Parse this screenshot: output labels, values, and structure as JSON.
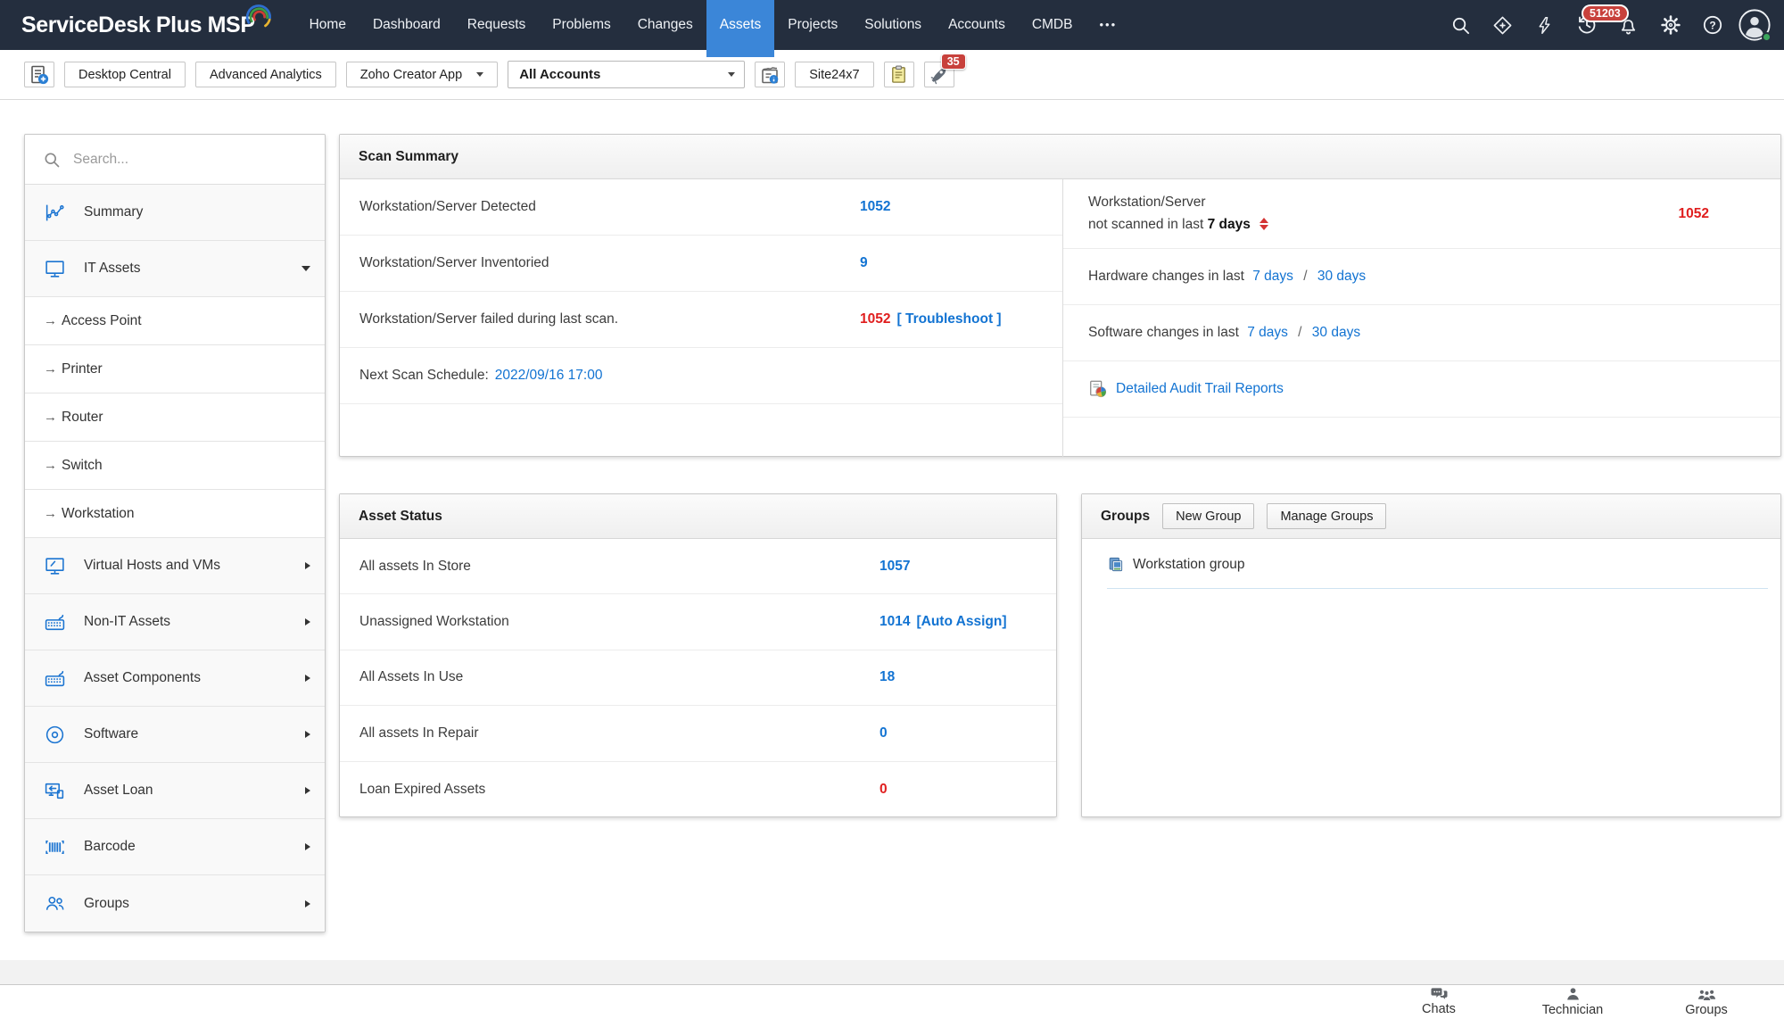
{
  "colors": {
    "nav_bg": "#242e3e",
    "active_tab_blue": "#3b86d8",
    "link_blue": "#1273d2",
    "alert_red": "#e01e1e",
    "badge_red": "#c8413c",
    "sidebar_icon_blue": "#1b74d1"
  },
  "nav": {
    "logo": "ServiceDesk Plus MSP",
    "items": [
      "Home",
      "Dashboard",
      "Requests",
      "Problems",
      "Changes",
      "Assets",
      "Projects",
      "Solutions",
      "Accounts",
      "CMDB",
      "•••"
    ],
    "active_tab": "Assets",
    "notifications_badge": "51203"
  },
  "toolbar": {
    "desktop_central": "Desktop Central",
    "advanced_analytics": "Advanced Analytics",
    "zoho_creator_app": "Zoho Creator App",
    "accounts_filter": "All Accounts",
    "site24x7": "Site24x7",
    "announcements_badge": "35"
  },
  "sidebar": {
    "search_placeholder": "Search...",
    "items": [
      {
        "label": "Summary"
      },
      {
        "label": "IT Assets"
      },
      {
        "label": "Access Point"
      },
      {
        "label": "Printer"
      },
      {
        "label": "Router"
      },
      {
        "label": "Switch"
      },
      {
        "label": "Workstation"
      },
      {
        "label": "Virtual Hosts and VMs"
      },
      {
        "label": "Non-IT Assets"
      },
      {
        "label": "Asset Components"
      },
      {
        "label": "Software"
      },
      {
        "label": "Asset Loan"
      },
      {
        "label": "Barcode"
      },
      {
        "label": "Groups"
      }
    ]
  },
  "scan_summary": {
    "title": "Scan Summary",
    "left_rows": [
      {
        "label": "Workstation/Server Detected",
        "value": "1052"
      },
      {
        "label": "Workstation/Server Inventoried",
        "value": "9"
      },
      {
        "label": "Workstation/Server failed during last scan.",
        "value": "1052",
        "link": "[ Troubleshoot ]"
      },
      {
        "label": "Next Scan Schedule:",
        "link": "2022/09/16 17:00"
      }
    ],
    "right": {
      "not_scanned_line1": "Workstation/Server",
      "not_scanned_line2": "not scanned in last",
      "not_scanned_bold": "7 days",
      "not_scanned_value": "1052",
      "hardware_label": "Hardware changes in last",
      "software_label": "Software changes in last",
      "days7": "7 days",
      "slash": "/",
      "days30": "30 days",
      "audit_link": "Detailed Audit Trail Reports"
    }
  },
  "asset_status": {
    "title": "Asset Status",
    "rows": [
      {
        "label": "All assets In Store",
        "value": "1057"
      },
      {
        "label": "Unassigned Workstation",
        "value": "1014",
        "extra": "[Auto Assign]"
      },
      {
        "label": "All Assets In Use",
        "value": "18"
      },
      {
        "label": "All assets In Repair",
        "value": "0"
      },
      {
        "label": "Loan Expired Assets",
        "value": "0"
      }
    ]
  },
  "groups_panel": {
    "title": "Groups",
    "new_group": "New Group",
    "manage_groups": "Manage Groups",
    "items": [
      {
        "label": "Workstation group"
      }
    ]
  },
  "footer": {
    "items": [
      {
        "label": "Chats"
      },
      {
        "label": "Technician"
      },
      {
        "label": "Groups"
      }
    ]
  }
}
